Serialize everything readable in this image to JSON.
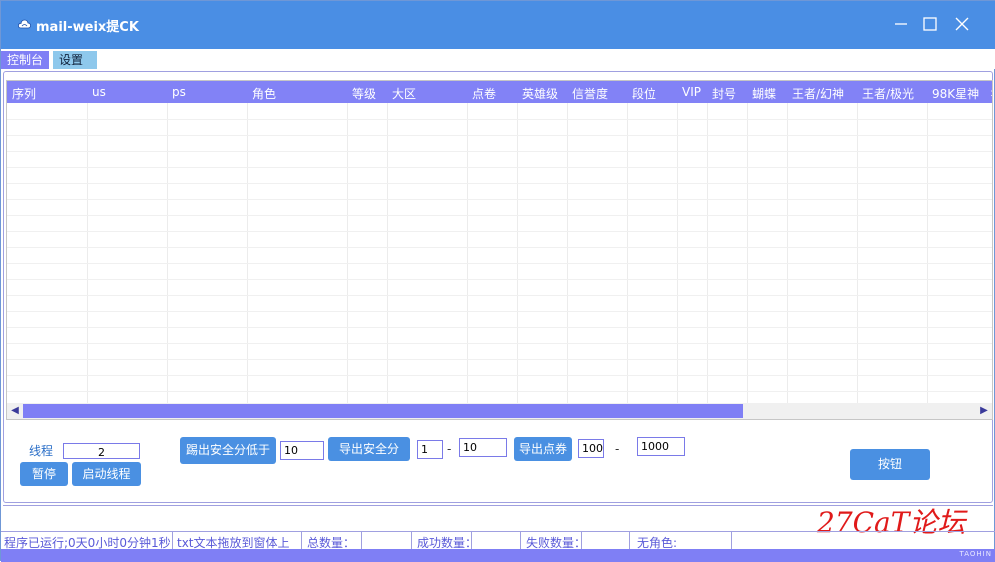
{
  "window": {
    "title": "mail-weix提CK",
    "icon": "cloud-app-icon",
    "colors": {
      "titlebar": "#4a8ee4",
      "accent": "#7f7ff5",
      "button": "#4a90e2"
    }
  },
  "menu": {
    "tabs": [
      {
        "label": "控制台",
        "active": true
      },
      {
        "label": "设置",
        "active": false
      }
    ]
  },
  "grid": {
    "columns": [
      "序列",
      "us",
      "ps",
      "角色",
      "等级",
      "大区",
      "点卷",
      "英雄级",
      "信誉度",
      "段位",
      "VIP",
      "封号",
      "蝴蝶",
      "王者/幻神",
      "王者/极光",
      "98K星神",
      "±"
    ],
    "rows": []
  },
  "controls": {
    "thread_label": "线程",
    "thread_value": "2",
    "pause_label": "暂停",
    "start_label": "启动线程",
    "kick_label": "踢出安全分低于",
    "kick_value": "10",
    "export_safe_label": "导出安全分",
    "range_from": "1",
    "range_to": "10",
    "export_points_label": "导出点券",
    "points_from": "100",
    "points_to": "1000",
    "dash": "-",
    "generic_button_label": "按钮"
  },
  "status": {
    "runtime": "程序已运行;0天0小时0分钟1秒",
    "drag_hint": "txt文本拖放到窗体上",
    "total_label": "总数量：",
    "total_value": "",
    "success_label": "成功数量：",
    "success_value": "",
    "fail_label": "失败数量：",
    "fail_value": "",
    "no_role_label": "无角色:",
    "no_role_value": ""
  },
  "footer": {
    "brand": "TAOHIN"
  },
  "watermark": {
    "text": "27CaT论坛"
  }
}
